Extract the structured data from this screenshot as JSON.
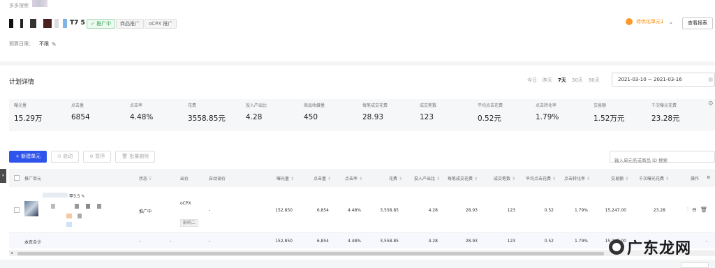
{
  "crumb": "多多搜索",
  "plan": {
    "suffix": "T7 5",
    "tags": [
      "推广中",
      "商品推广",
      "oCPX 推广"
    ],
    "budget_label": "预算日限：",
    "budget_value": "不限",
    "owner": "待优化单元1",
    "report_button": "查看报表"
  },
  "detail": {
    "title": "计划详情",
    "ranges": [
      "今日",
      "昨天",
      "7天",
      "30天",
      "90天"
    ],
    "active_range": "7天",
    "date_range": "2021-03-10 ~ 2021-03-16"
  },
  "metrics": [
    {
      "label": "曝光量",
      "value": "15.29万"
    },
    {
      "label": "点击量",
      "value": "6854"
    },
    {
      "label": "点击率",
      "value": "4.48%"
    },
    {
      "label": "花费",
      "value": "3558.85元"
    },
    {
      "label": "投入产出比",
      "value": "4.28"
    },
    {
      "label": "商品收藏量",
      "value": "450"
    },
    {
      "label": "每笔成交花费",
      "value": "28.93"
    },
    {
      "label": "成交笔数",
      "value": "123"
    },
    {
      "label": "平均点击花费",
      "value": "0.52元"
    },
    {
      "label": "点击转化率",
      "value": "1.79%"
    },
    {
      "label": "交易额",
      "value": "1.52万元"
    },
    {
      "label": "千次曝光花费",
      "value": "23.28元"
    }
  ],
  "toolbar": {
    "new_unit": "+ 新建单元",
    "start": "⊙ 启动",
    "pause": "⊖ 暂停",
    "delete": "🗑 批量删除",
    "search_placeholder": "输入单元名或商品 ID 搜索"
  },
  "table": {
    "headers": {
      "unit": "推广单元",
      "status": "状态",
      "bid": "出价",
      "auto_bid": "自动调价",
      "impr": "曝光量",
      "clicks": "点击量",
      "ctr": "点击率",
      "cost": "花费",
      "roi": "投入产出比",
      "cost_per_order": "每笔成交花费",
      "orders": "成交笔数",
      "cpc": "平均点击花费",
      "cvr": "点击转化率",
      "gmv": "交易额",
      "cpm": "千次曝光花费",
      "ops": "操作"
    },
    "row": {
      "unit_name_suffix": "甲3.5",
      "status": "推广中",
      "bid": "oCPX",
      "bid_sub": "影响二",
      "auto_bid": "-",
      "impr": "152,850",
      "clicks": "6,854",
      "ctr": "4.48%",
      "cost": "3,558.85",
      "roi": "4.28",
      "cost_per_order": "28.93",
      "orders": "123",
      "cpc": "0.52",
      "cvr": "1.79%",
      "gmv": "15,247.00",
      "cpm": "23.28"
    },
    "total": {
      "label": "本页合计",
      "status": "-",
      "bid": "-",
      "auto_bid": "-",
      "impr": "152,850",
      "clicks": "6,854",
      "ctr": "4.48%",
      "cost": "3,558.85",
      "roi": "4.28",
      "cost_per_order": "28.93",
      "orders": "123",
      "cpc": "0.52",
      "cvr": "1.79%",
      "gmv": "15,247.00",
      "cpm": "-"
    }
  },
  "watermark": "广东龙网"
}
